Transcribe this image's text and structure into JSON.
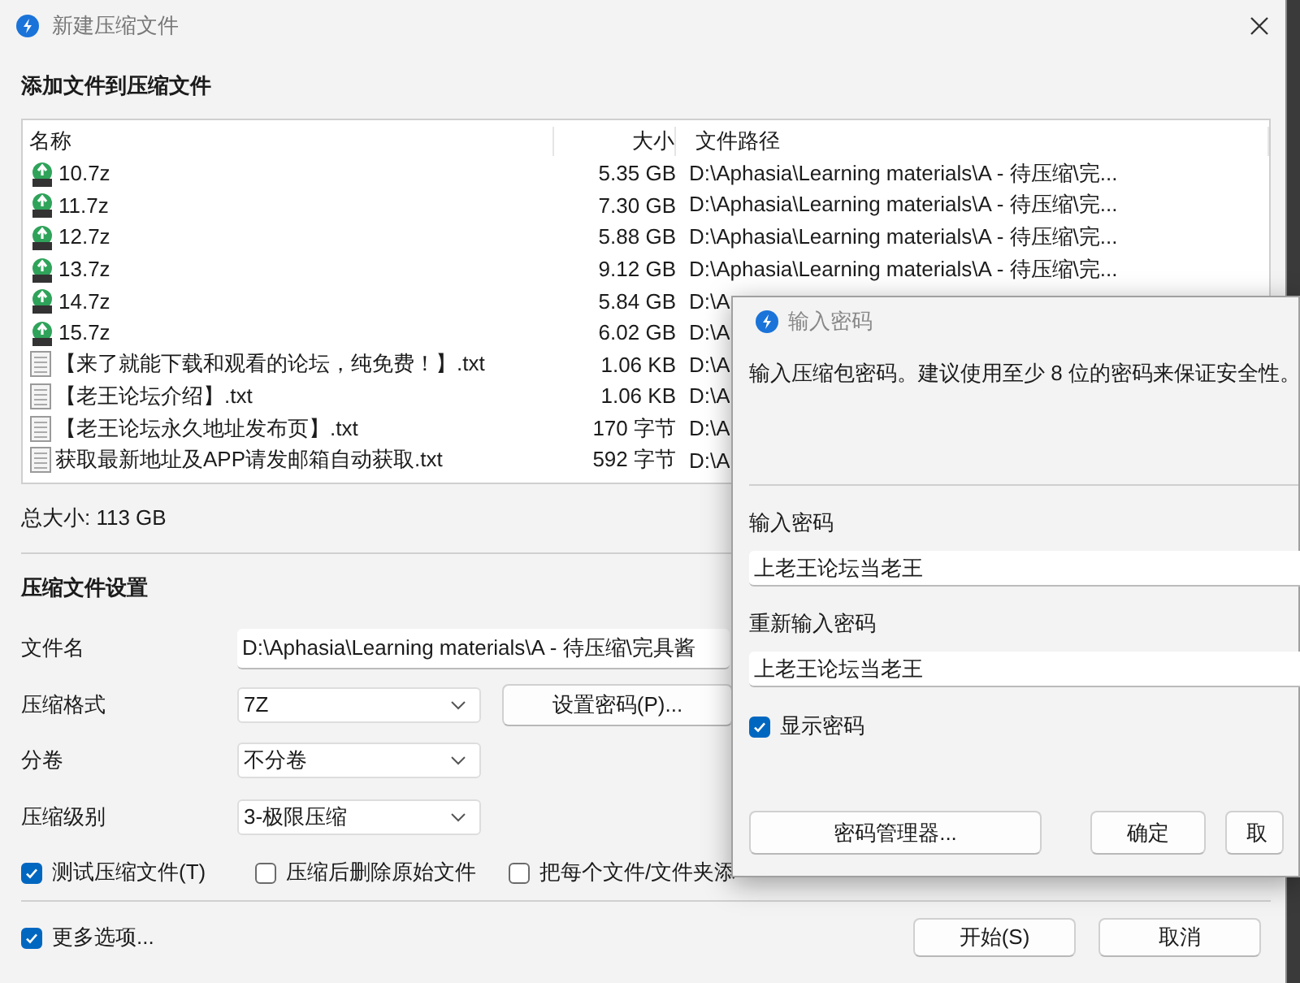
{
  "main_window": {
    "title": "新建压缩文件",
    "heading": "添加文件到压缩文件",
    "file_list": {
      "columns": [
        "名称",
        "大小",
        "文件路径"
      ],
      "rows": [
        {
          "kind": "archive",
          "name": "10.7z",
          "size": "5.35 GB",
          "path": "D:\\Aphasia\\Learning materials\\A - 待压缩\\完..."
        },
        {
          "kind": "archive",
          "name": "11.7z",
          "size": "7.30 GB",
          "path": "D:\\Aphasia\\Learning materials\\A - 待压缩\\完..."
        },
        {
          "kind": "archive",
          "name": "12.7z",
          "size": "5.88 GB",
          "path": "D:\\Aphasia\\Learning materials\\A - 待压缩\\完..."
        },
        {
          "kind": "archive",
          "name": "13.7z",
          "size": "9.12 GB",
          "path": "D:\\Aphasia\\Learning materials\\A - 待压缩\\完..."
        },
        {
          "kind": "archive",
          "name": "14.7z",
          "size": "5.84 GB",
          "path": "D:\\A"
        },
        {
          "kind": "archive",
          "name": "15.7z",
          "size": "6.02 GB",
          "path": "D:\\A"
        },
        {
          "kind": "text",
          "name": "【来了就能下载和观看的论坛，纯免费！】.txt",
          "size": "1.06 KB",
          "path": "D:\\A"
        },
        {
          "kind": "text",
          "name": "【老王论坛介绍】.txt",
          "size": "1.06 KB",
          "path": "D:\\A"
        },
        {
          "kind": "text",
          "name": "【老王论坛永久地址发布页】.txt",
          "size": "170 字节",
          "path": "D:\\A"
        },
        {
          "kind": "text",
          "name": "获取最新地址及APP请发邮箱自动获取.txt",
          "size": "592 字节",
          "path": "D:\\A"
        }
      ]
    },
    "total_size": "总大小: 113 GB",
    "settings": {
      "heading": "压缩文件设置",
      "filename_label": "文件名",
      "filename": "D:\\Aphasia\\Learning materials\\A - 待压缩\\完具酱",
      "format_label": "压缩格式",
      "format": "7Z",
      "set_password_button": "设置密码(P)...",
      "split_label": "分卷",
      "split": "不分卷",
      "level_label": "压缩级别",
      "level": "3-极限压缩"
    },
    "options": [
      {
        "label": "测试压缩文件(T)",
        "checked": true
      },
      {
        "label": "压缩后删除原始文件",
        "checked": false
      },
      {
        "label": "把每个文件/文件夹添",
        "checked": false
      }
    ],
    "more_options": {
      "label": "更多选项...",
      "checked": true
    },
    "buttons": [
      "开始(S)",
      "取消"
    ]
  },
  "password_dialog": {
    "title": "输入密码",
    "message": "输入压缩包密码。建议使用至少 8 位的密码来保证安全性。",
    "password_label": "输入密码",
    "password": "上老王论坛当老王",
    "confirm_label": "重新输入密码",
    "confirm": "上老王论坛当老王",
    "show_password": {
      "label": "显示密码",
      "checked": true
    },
    "buttons": [
      "密码管理器...",
      "确定",
      "取"
    ]
  }
}
